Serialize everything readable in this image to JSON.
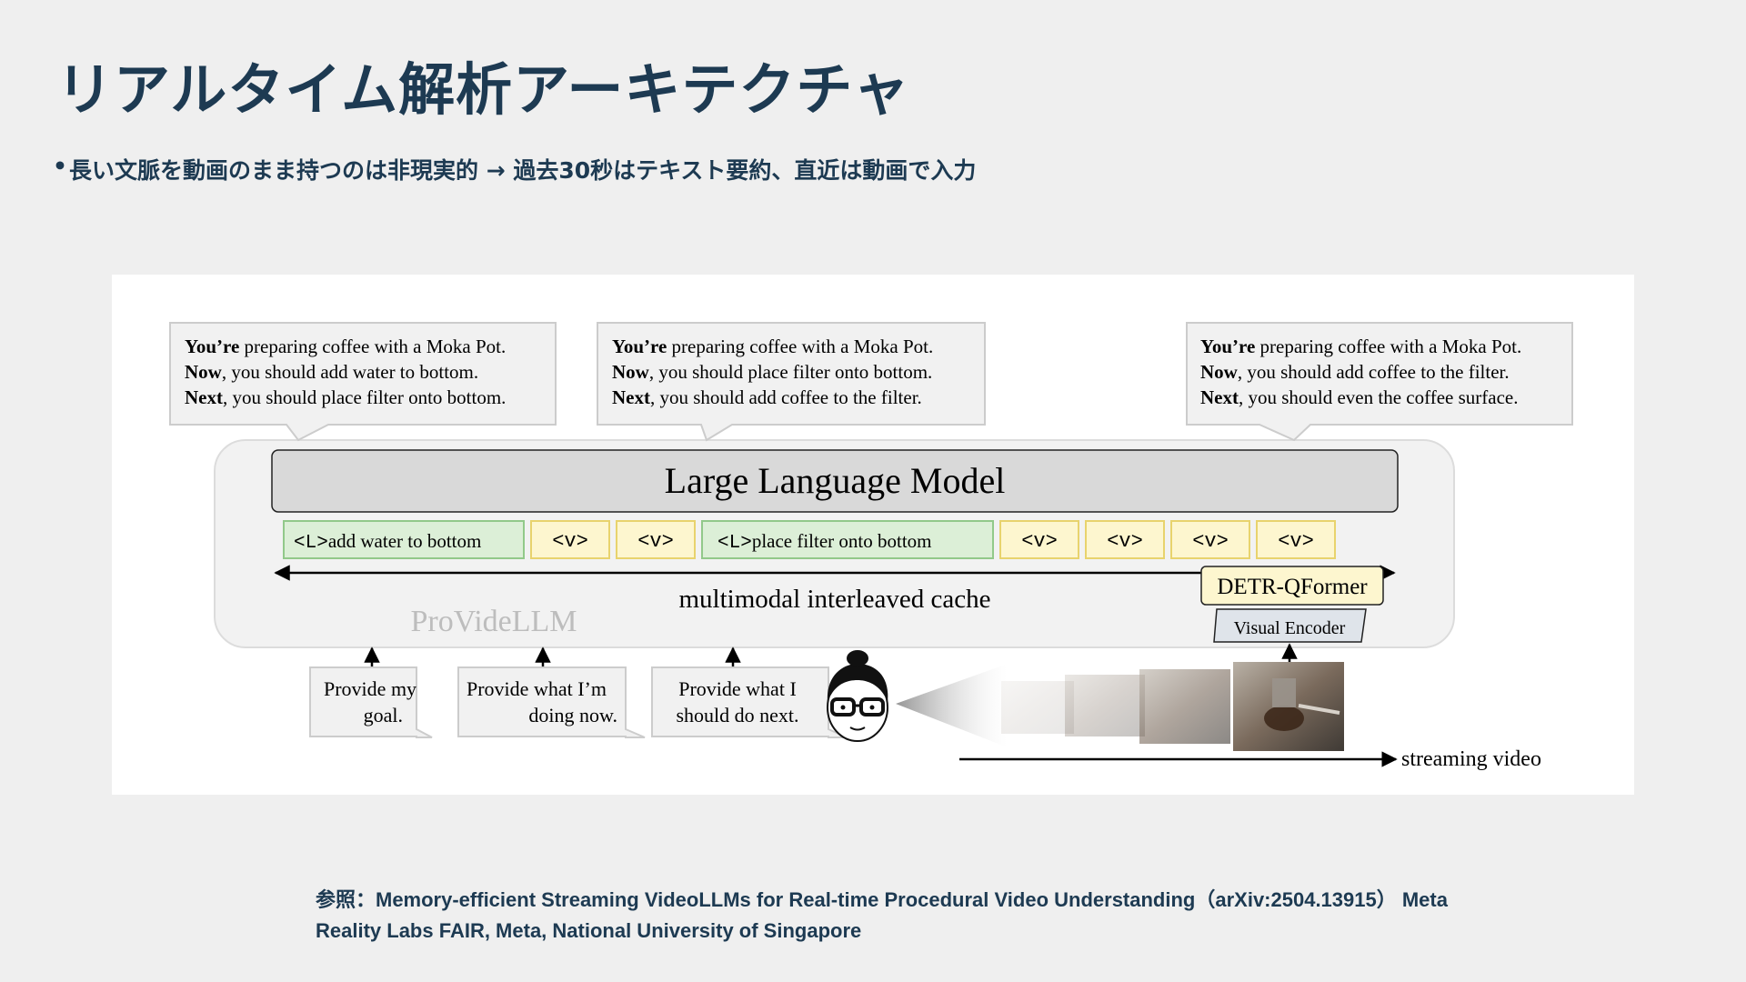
{
  "slide": {
    "title": "リアルタイム解析アーキテクチャ",
    "bullet": "長い文脈を動画のまま持つのは非現実的 → 過去30秒はテキスト要約、直近は動画で入力",
    "reference": "参照：Memory-efficient Streaming VideoLLMs for Real-time Procedural Video Understanding（arXiv:2504.13915） Meta Reality Labs FAIR, Meta, National University of Singapore"
  },
  "diagram": {
    "bubbles": [
      {
        "line1_bold": "You’re",
        "line1_rest": " preparing coffee with a Moka Pot.",
        "line2_bold": "Now",
        "line2_rest": ", you should add water to bottom.",
        "line3_bold": "Next",
        "line3_rest": ", you should place filter onto bottom."
      },
      {
        "line1_bold": "You’re",
        "line1_rest": " preparing coffee with a Moka Pot.",
        "line2_bold": "Now",
        "line2_rest": ", you should place filter onto bottom.",
        "line3_bold": "Next",
        "line3_rest": ", you should add coffee to the filter."
      },
      {
        "line1_bold": "You’re",
        "line1_rest": " preparing coffee with a Moka Pot.",
        "line2_bold": "Now",
        "line2_rest": ", you should add coffee to the filter.",
        "line3_bold": "Next",
        "line3_rest": ", you should even the coffee surface."
      }
    ],
    "llm_label": "Large Language Model",
    "tokens": {
      "l1_tag": "<L>",
      "l1_text": "add water to bottom",
      "v": "<v>",
      "l2_tag": "<L>",
      "l2_text": "place filter onto bottom"
    },
    "cache_label": "multimodal interleaved cache",
    "model_name": "ProVideLLM",
    "qformer_label": "DETR-QFormer",
    "encoder_label": "Visual Encoder",
    "queries": [
      {
        "line1": "Provide my",
        "line2": "goal."
      },
      {
        "line1": "Provide what I’m",
        "line2": "doing now."
      },
      {
        "line1": "Provide what I",
        "line2": "should do next."
      }
    ],
    "stream_label": "streaming video",
    "icons": {
      "user": "user-glasses-icon",
      "frames": "video-frame-thumbnails"
    },
    "colors": {
      "l_token_fill": "#dcefd7",
      "l_token_stroke": "#92c98a",
      "v_token_fill": "#fdf6cf",
      "v_token_stroke": "#e8d36d",
      "llm_fill": "#d9d9d9",
      "container_fill": "#f2f2f2"
    }
  }
}
